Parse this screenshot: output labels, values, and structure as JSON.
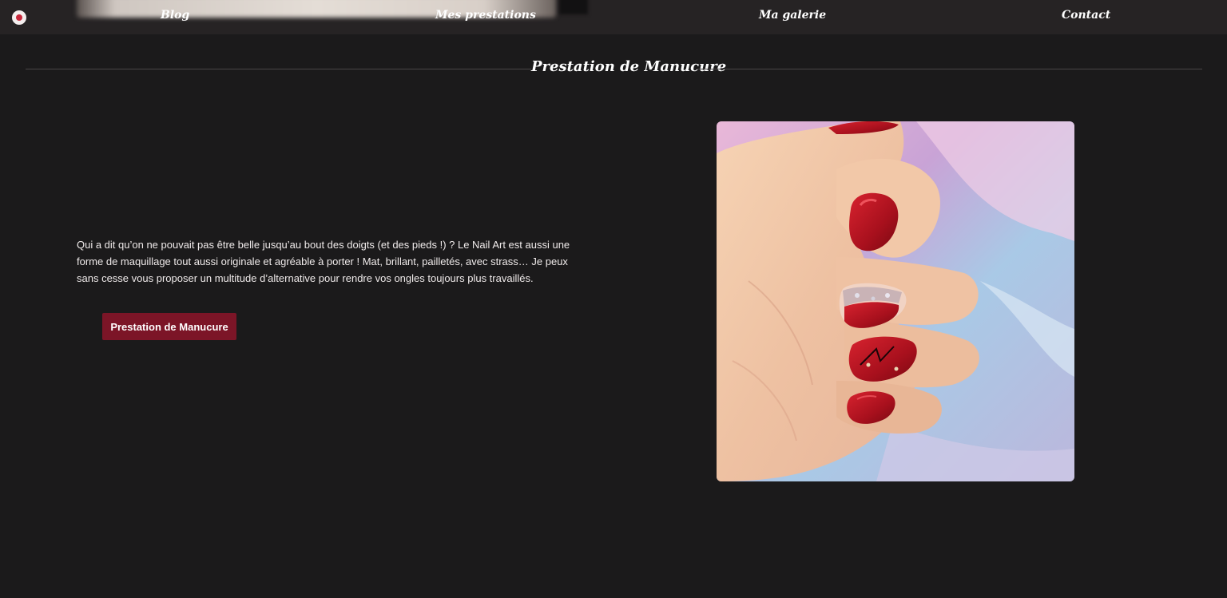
{
  "nav": {
    "items": [
      {
        "label": "Blog"
      },
      {
        "label": "Mes prestations"
      },
      {
        "label": "Ma galerie"
      },
      {
        "label": "Contact"
      }
    ]
  },
  "section": {
    "title": "Prestation de Manucure"
  },
  "content": {
    "description": "Qui a dit qu’on ne pouvait pas être belle jusqu’au bout des doigts (et des pieds !) ? Le Nail Art est aussi une forme de maquillage tout aussi originale et agréable à porter ! Mat, brillant, pailletés, avec strass… Je peux sans cesse vous proposer un multitude d’alternative pour rendre vos ongles toujours plus travaillés.",
    "button_label": "Prestation de Manucure"
  },
  "icons": {
    "logo": "brand-logo-icon",
    "photo": "manicure-photo"
  },
  "colors": {
    "background": "#1b1a1b",
    "topbar": "#262324",
    "accent": "#7c1527",
    "text": "#ffffff"
  }
}
